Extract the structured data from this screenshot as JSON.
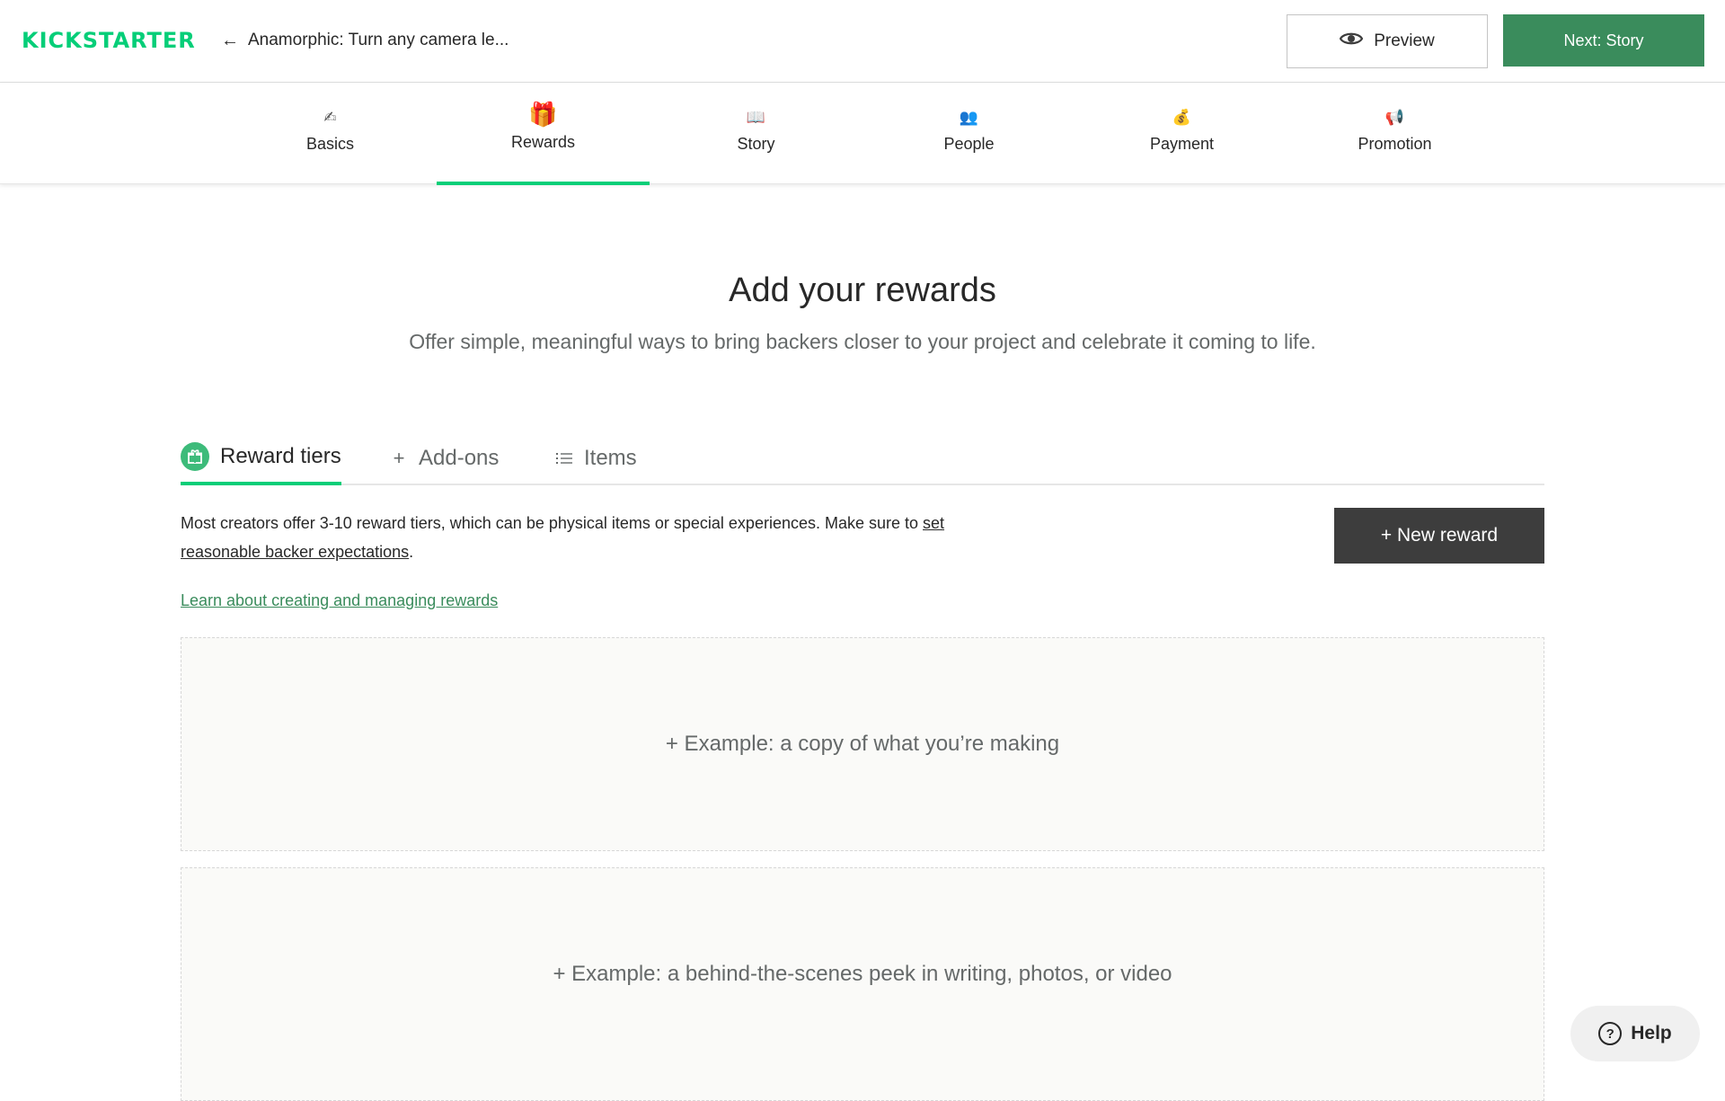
{
  "header": {
    "logo_text": "KICKSTARTER",
    "back_arrow": "←",
    "project_title": "Anamorphic: Turn any camera le...",
    "preview_label": "Preview",
    "next_label": "Next: Story"
  },
  "steps": [
    {
      "label": "Basics",
      "icon": "pencil-icon",
      "glyph": "✍",
      "active": false
    },
    {
      "label": "Rewards",
      "icon": "gift-icon",
      "glyph": "🎁",
      "active": true
    },
    {
      "label": "Story",
      "icon": "book-icon",
      "glyph": "📖",
      "active": false
    },
    {
      "label": "People",
      "icon": "people-icon",
      "glyph": "👥",
      "active": false
    },
    {
      "label": "Payment",
      "icon": "money-bag-icon",
      "glyph": "💰",
      "active": false
    },
    {
      "label": "Promotion",
      "icon": "megaphone-icon",
      "glyph": "📢",
      "active": false
    }
  ],
  "main": {
    "title": "Add your rewards",
    "subtitle": "Offer simple, meaningful ways to bring backers closer to your project and celebrate it coming to life."
  },
  "subtabs": [
    {
      "label": "Reward tiers",
      "icon": "gift-icon",
      "glyph": "⌂",
      "active": true
    },
    {
      "label": "Add-ons",
      "icon": "plus-icon",
      "glyph": "+",
      "active": false
    },
    {
      "label": "Items",
      "icon": "list-icon",
      "glyph": "≡",
      "active": false
    }
  ],
  "description": {
    "text_before": "Most creators offer 3-10 reward tiers, which can be physical items or special experiences. Make sure to ",
    "link_text": "set reasonable backer expectations",
    "text_after": "."
  },
  "new_reward_label": "+ New reward",
  "learn_link": "Learn about creating and managing rewards",
  "examples": [
    "+ Example: a copy of what you’re making",
    "+ Example: a behind-the-scenes peek in writing, photos, or video"
  ],
  "help": {
    "glyph": "?",
    "label": "Help"
  },
  "colors": {
    "brand_green": "#05ce78",
    "next_button": "#3a8c5c",
    "new_reward_button": "#3d3d3d",
    "link_green": "#3a8c5c"
  }
}
